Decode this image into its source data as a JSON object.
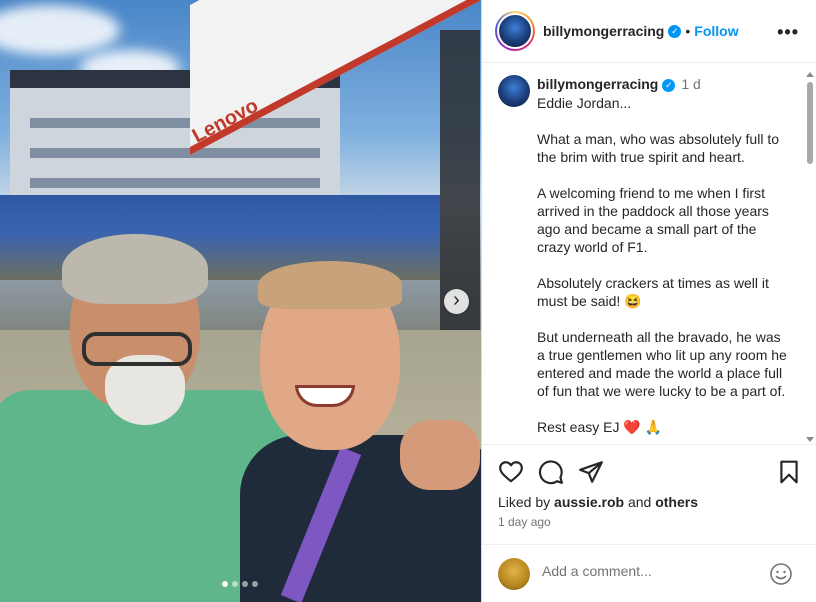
{
  "post": {
    "username": "billymongerracing",
    "separator": "•",
    "follow_label": "Follow",
    "more_label": "•••",
    "time_short": "1 d",
    "caption": "Eddie Jordan...\n\nWhat a man, who was absolutely full to the brim with true spirit and heart.\n\nA welcoming friend to me when I first arrived in the paddock all those years ago and became a small part of the crazy world of F1.\n\nAbsolutely crackers at times as well it must be said! 😆\n\nBut underneath all the bravado, he was a true gentlemen who lit up any room he entered and made the world a place full of fun that we were lucky to be a part of.\n\nRest easy EJ ❤️ 🙏",
    "liked_prefix": "Liked by ",
    "liked_user": "aussie.rob",
    "liked_mid": " and ",
    "liked_others": "others",
    "time_long": "1 day ago",
    "verified_glyph": "✓"
  },
  "carousel": {
    "next_glyph": "›",
    "dots": 4,
    "active_index": 0,
    "photo_sign": "Lenovo"
  },
  "comment": {
    "placeholder": "Add a comment..."
  },
  "icons": {
    "like": "heart-icon",
    "comment": "comment-icon",
    "share": "share-icon",
    "save": "bookmark-icon",
    "emoji": "emoji-icon",
    "more": "more-icon",
    "next": "chevron-right-icon"
  },
  "colors": {
    "accent": "#0095f6",
    "text": "#262626",
    "muted": "#737373"
  }
}
